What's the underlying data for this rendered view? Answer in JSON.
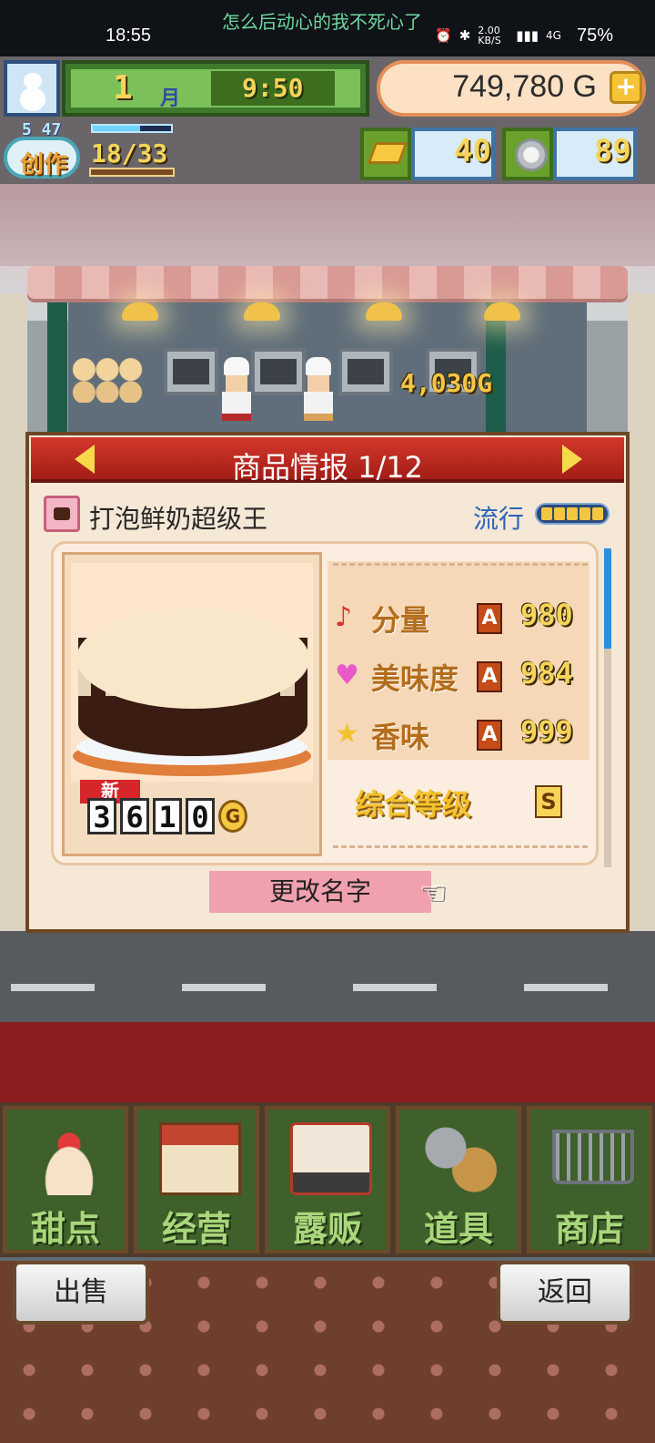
{
  "status_bar": {
    "time": "18:55",
    "banner": "怎么后动心的我不死心了",
    "net_speed": "2.00 KB/S",
    "network": "4G",
    "battery": "75%"
  },
  "hud": {
    "month": "1",
    "month_unit": "月",
    "clock": "9:50",
    "money": "749,780 G",
    "add_icon": "plus-icon",
    "level": "5 47",
    "create_label": "创作",
    "recipes": "18/33",
    "gold_bars": "40",
    "silver_coins": "89"
  },
  "scene": {
    "earnings_popup": "4,030G"
  },
  "dialog": {
    "title": "商品情报 1/12",
    "product_name": "打泡鲜奶超级王",
    "trend_label": "流行",
    "trend_level": 5,
    "new_badge": "新",
    "price_digits": [
      "3",
      "6",
      "1",
      "0"
    ],
    "price_unit": "G",
    "stats": [
      {
        "icon": "music-note-icon",
        "label": "分量",
        "grade": "A",
        "value": "980"
      },
      {
        "icon": "heart-icon",
        "label": "美味度",
        "grade": "A",
        "value": "984"
      },
      {
        "icon": "star-icon",
        "label": "香味",
        "grade": "A",
        "value": "999"
      }
    ],
    "overall_label": "综合等级",
    "overall_grade": "S",
    "rename_button": "更改名字"
  },
  "menu": {
    "items": [
      {
        "label": "甜点",
        "icon": "cake-icon"
      },
      {
        "label": "经营",
        "icon": "shop-icon"
      },
      {
        "label": "露贩",
        "icon": "food-truck-icon"
      },
      {
        "label": "道具",
        "icon": "item-bag-icon"
      },
      {
        "label": "商店",
        "icon": "cart-icon"
      }
    ]
  },
  "bottom": {
    "sell_button": "出售",
    "back_button": "返回"
  },
  "colors": {
    "header_red": "#c12a21",
    "stat_gold": "#f6d45a",
    "menu_green": "#3f5f2b",
    "trend_blue": "#2d63b8"
  }
}
